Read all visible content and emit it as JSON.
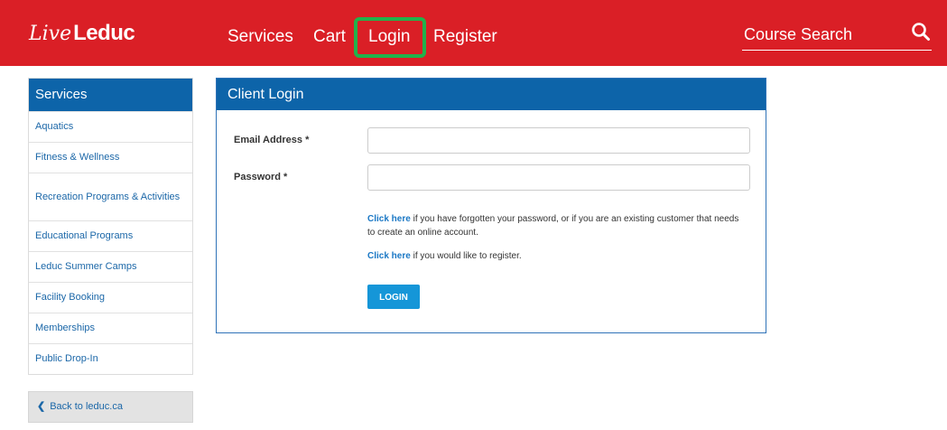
{
  "header": {
    "logo_script": "Live",
    "logo_main": "Leduc",
    "nav": {
      "services": "Services",
      "cart": "Cart",
      "login": "Login",
      "register": "Register"
    },
    "search_placeholder": "Course Search",
    "search_icon": "search-icon",
    "background_color": "#da1f26",
    "highlight_color": "#21b24b"
  },
  "sidebar": {
    "title": "Services",
    "items": [
      {
        "label": "Aquatics"
      },
      {
        "label": "Fitness & Wellness"
      },
      {
        "label": "Recreation Programs & Activities"
      },
      {
        "label": "Educational Programs"
      },
      {
        "label": "Leduc Summer Camps"
      },
      {
        "label": "Facility Booking"
      },
      {
        "label": "Memberships"
      },
      {
        "label": "Public Drop-In"
      }
    ],
    "back_label": "Back to leduc.ca",
    "back_icon": "chevron-left-icon"
  },
  "login_panel": {
    "title": "Client Login",
    "email_label": "Email Address *",
    "email_value": "",
    "password_label": "Password *",
    "password_value": "",
    "forgot_link": "Click here",
    "forgot_text": " if you have forgotten your password, or if you are an existing customer that needs to create an online account.",
    "register_link": "Click here",
    "register_text": " if you would like to register.",
    "login_button": "LOGIN",
    "accent_color": "#0d64a9",
    "button_color": "#1596d8"
  }
}
